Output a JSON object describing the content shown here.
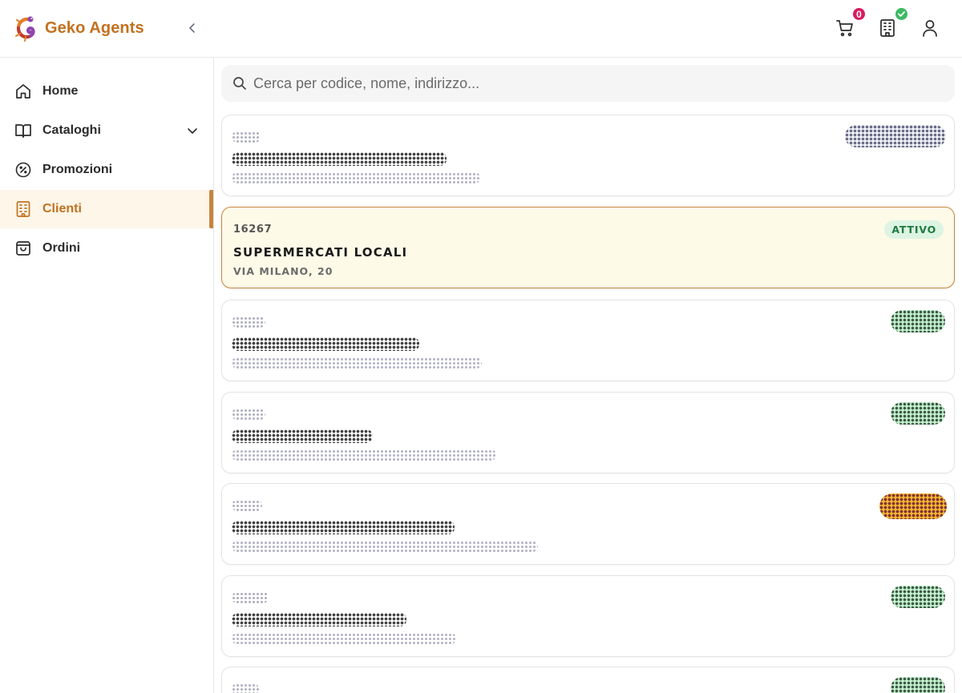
{
  "app": {
    "brand_name": "Geko Agents",
    "accent_color": "#c2711f"
  },
  "header": {
    "cart_count": "0",
    "icons": [
      "cart-icon",
      "building-icon",
      "user-icon",
      "check-icon",
      "chevron-left-icon"
    ]
  },
  "sidebar": {
    "items": [
      {
        "label": "Home",
        "icon": "home-icon"
      },
      {
        "label": "Cataloghi",
        "icon": "book-icon",
        "has_submenu": true
      },
      {
        "label": "Promozioni",
        "icon": "percent-badge-icon"
      },
      {
        "label": "Clienti",
        "icon": "building-icon",
        "active": true
      },
      {
        "label": "Ordini",
        "icon": "shopping-bag-icon"
      }
    ]
  },
  "search": {
    "placeholder": "Cerca per codice, nome, indirizzo..."
  },
  "clients": {
    "selected": {
      "code": "16267",
      "name": "SUPERMERCATI LOCALI",
      "address": "VIA MILANO, 20",
      "status": "ATTIVO",
      "status_color": "#1f7a3f"
    },
    "redacted_status_colors": [
      "#eceef4",
      "#b8f0c4",
      "#b8f0c4",
      "#f5b128",
      "#b8f0c4",
      "#b8f0c4"
    ]
  }
}
